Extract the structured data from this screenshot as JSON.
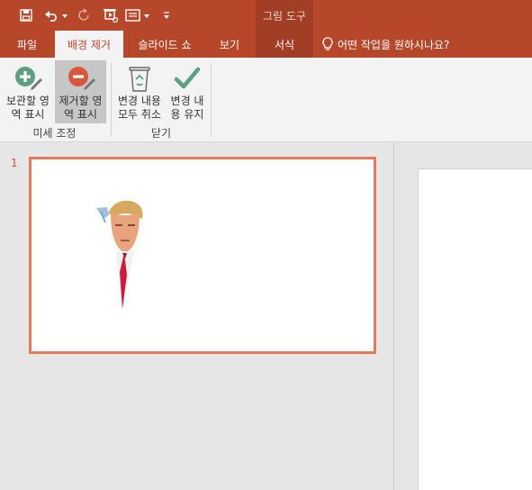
{
  "qat": {
    "icons": [
      "save-icon",
      "undo-icon",
      "redo-icon",
      "from-beginning-icon",
      "presenter-icon",
      "customize-icon"
    ]
  },
  "contextual_header": "그림 도구",
  "tabs": [
    {
      "label": "파일"
    },
    {
      "label": "배경 제거",
      "active": true
    },
    {
      "label": "슬라이드 쇼"
    },
    {
      "label": "보기"
    },
    {
      "label": "서식",
      "contextual": true
    }
  ],
  "tell_me": "어떤 작업을 원하시나요?",
  "ribbon": {
    "groups": [
      {
        "label": "미세 조정",
        "buttons": [
          {
            "line1": "보관할 영",
            "line2": "역 표시",
            "icon": "plus-pencil-icon"
          },
          {
            "line1": "제거할 영",
            "line2": "역 표시",
            "icon": "minus-pencil-icon",
            "pressed": true
          }
        ]
      },
      {
        "label": "닫기",
        "buttons": [
          {
            "line1": "변경 내용",
            "line2": "모두 취소",
            "icon": "recycle-bin-icon"
          },
          {
            "line1": "변경 내",
            "line2": "용 유지",
            "icon": "checkmark-icon"
          }
        ]
      }
    ]
  },
  "slides": [
    {
      "number": "1",
      "image": "portrait-cutout"
    }
  ],
  "colors": {
    "accent": "#b7472a",
    "contextual": "#a23e25",
    "thumb_border": "#e8785a",
    "pressed": "#c6c6c6"
  }
}
